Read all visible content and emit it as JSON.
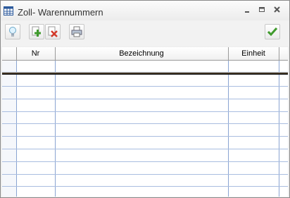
{
  "window": {
    "title": "Zoll- Warennummern",
    "icon": "table-icon",
    "controls": {
      "minimize": "minimize-icon",
      "maximize": "maximize-icon",
      "close": "close-icon"
    }
  },
  "toolbar": {
    "buttons": [
      {
        "name": "tip-button",
        "icon": "lightbulb-icon"
      },
      {
        "name": "add-button",
        "icon": "add-record-icon"
      },
      {
        "name": "delete-button",
        "icon": "delete-record-icon"
      },
      {
        "name": "print-button",
        "icon": "printer-icon"
      },
      {
        "name": "confirm-button",
        "icon": "checkmark-icon"
      }
    ]
  },
  "table": {
    "columns": [
      "",
      "Nr",
      "Bezeichnung",
      "Einheit",
      ""
    ],
    "row_count": 10
  },
  "colors": {
    "accent_green": "#3f9a2c",
    "delete_red": "#d33a2a",
    "grid_line": "#8aa4d2"
  }
}
